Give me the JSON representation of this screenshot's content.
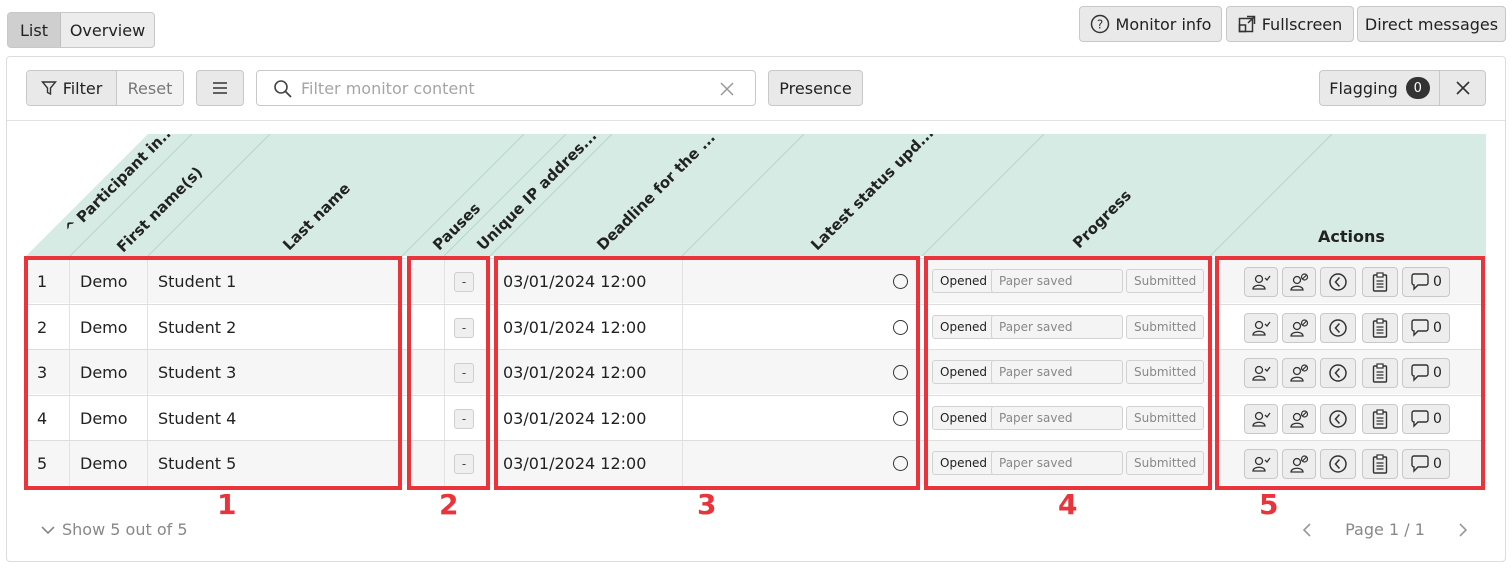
{
  "view_tabs": {
    "list": "List",
    "overview": "Overview"
  },
  "top_actions": {
    "monitor_info": "Monitor info",
    "fullscreen": "Fullscreen",
    "direct_messages": "Direct messages"
  },
  "toolbar": {
    "filter_label": "Filter",
    "reset_label": "Reset",
    "search_placeholder": "Filter monitor content",
    "presence_label": "Presence",
    "flagging_label": "Flagging",
    "flagging_count": "0"
  },
  "columns": {
    "participant": "Participant in...",
    "first_name": "First name(s)",
    "last_name": "Last name",
    "pauses": "Pauses",
    "unique_ip": "Unique IP addres...",
    "deadline": "Deadline for the ...",
    "latest_status": "Latest status upd...",
    "progress": "Progress",
    "actions": "Actions",
    "sort_indicator": "^"
  },
  "progress_labels": {
    "opened": "Opened",
    "paper_saved": "Paper saved",
    "submitted": "Submitted"
  },
  "rows": [
    {
      "index": "1",
      "first": "Demo",
      "last": "Student 1",
      "pause": "-",
      "deadline": "03/01/2024 12:00",
      "messages": "0"
    },
    {
      "index": "2",
      "first": "Demo",
      "last": "Student 2",
      "pause": "-",
      "deadline": "03/01/2024 12:00",
      "messages": "0"
    },
    {
      "index": "3",
      "first": "Demo",
      "last": "Student 3",
      "pause": "-",
      "deadline": "03/01/2024 12:00",
      "messages": "0"
    },
    {
      "index": "4",
      "first": "Demo",
      "last": "Student 4",
      "pause": "-",
      "deadline": "03/01/2024 12:00",
      "messages": "0"
    },
    {
      "index": "5",
      "first": "Demo",
      "last": "Student 5",
      "pause": "-",
      "deadline": "03/01/2024 12:00",
      "messages": "0"
    }
  ],
  "annotations": [
    "1",
    "2",
    "3",
    "4",
    "5"
  ],
  "footer": {
    "show_count": "Show 5 out of 5",
    "page": "Page 1 / 1"
  },
  "colors": {
    "header_bg": "#d5ebe4",
    "annotation": "#e8343a"
  }
}
